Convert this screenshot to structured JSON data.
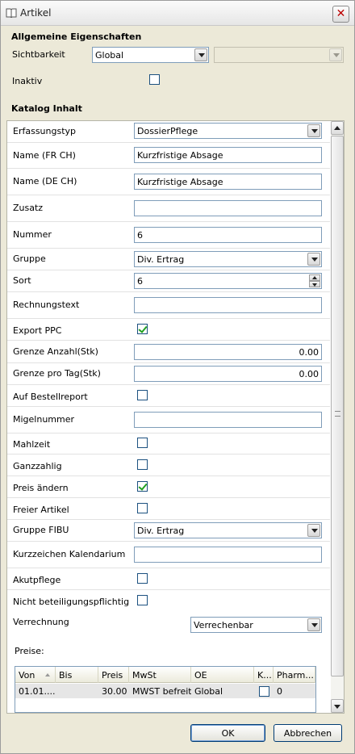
{
  "window": {
    "title": "Artikel",
    "close_glyph": "✕"
  },
  "general": {
    "heading": "Allgemeine Eigenschaften",
    "sichtbarkeit_label": "Sichtbarkeit",
    "sichtbarkeit_value": "Global",
    "secondary_value": "",
    "inaktiv_label": "Inaktiv",
    "inaktiv_checked": false
  },
  "katalog": {
    "heading": "Katalog Inhalt",
    "fields": {
      "erfassungstyp": {
        "label": "Erfassungstyp",
        "value": "DossierPflege"
      },
      "name_fr": {
        "label": "Name (FR CH)",
        "value": "Kurzfristige Absage"
      },
      "name_de": {
        "label": "Name (DE CH)",
        "value": "Kurzfristige Absage"
      },
      "zusatz": {
        "label": "Zusatz",
        "value": ""
      },
      "nummer": {
        "label": "Nummer",
        "value": "6"
      },
      "gruppe": {
        "label": "Gruppe",
        "value": "Div. Ertrag"
      },
      "sort": {
        "label": "Sort",
        "value": "6"
      },
      "rechnungstext": {
        "label": "Rechnungstext",
        "value": ""
      },
      "export_ppc": {
        "label": "Export PPC",
        "checked": true
      },
      "grenze_anzahl": {
        "label": "Grenze Anzahl(Stk)",
        "value": "0.00"
      },
      "grenze_tag": {
        "label": "Grenze pro Tag(Stk)",
        "value": "0.00"
      },
      "auf_bestellreport": {
        "label": "Auf Bestellreport",
        "checked": false
      },
      "migelnummer": {
        "label": "Migelnummer",
        "value": ""
      },
      "mahlzeit": {
        "label": "Mahlzeit",
        "checked": false
      },
      "ganzzahlig": {
        "label": "Ganzzahlig",
        "checked": false
      },
      "preis_aendern": {
        "label": "Preis ändern",
        "checked": true
      },
      "freier_artikel": {
        "label": "Freier Artikel",
        "checked": false
      },
      "gruppe_fibu": {
        "label": "Gruppe FIBU",
        "value": "Div. Ertrag"
      },
      "kurzzeichen": {
        "label": "Kurzzeichen Kalendarium",
        "value": ""
      },
      "akutpflege": {
        "label": "Akutpflege",
        "checked": false
      },
      "nicht_beteiligung": {
        "label": "Nicht beteiligungspflichtig",
        "checked": false
      },
      "verrechnung": {
        "label": "Verrechnung",
        "value": "Verrechenbar"
      }
    },
    "preise": {
      "label": "Preise:",
      "columns": [
        "Von",
        "Bis",
        "Preis",
        "MwSt",
        "OE",
        "K...",
        "Pharm..."
      ],
      "rows": [
        {
          "von": "01.01....",
          "bis": "",
          "preis": "30.00",
          "mwst": "MWST befreit",
          "oe": "Global",
          "k": false,
          "pharm": "0"
        }
      ]
    }
  },
  "buttons": {
    "ok": "OK",
    "cancel": "Abbrechen"
  }
}
